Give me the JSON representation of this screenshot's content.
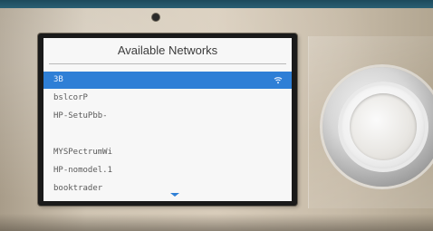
{
  "screen": {
    "title": "Available Networks",
    "networks": [
      {
        "ssid": "3B",
        "selected": true,
        "signal_icon": "wifi-icon"
      },
      {
        "ssid": "bslcorP",
        "selected": false
      },
      {
        "ssid": "HP-SetuPbb-",
        "selected": false
      },
      {
        "ssid": "",
        "selected": false
      },
      {
        "ssid": "MYSPectrumWi",
        "selected": false
      },
      {
        "ssid": "HP-nomodel.1",
        "selected": false
      },
      {
        "ssid": "booktrader",
        "selected": false
      }
    ],
    "scroll_indicator": "chevron-down-icon"
  },
  "colors": {
    "selection": "#2e7fd6",
    "screen_bg": "#f7f7f7",
    "text": "#5a5a5a"
  }
}
